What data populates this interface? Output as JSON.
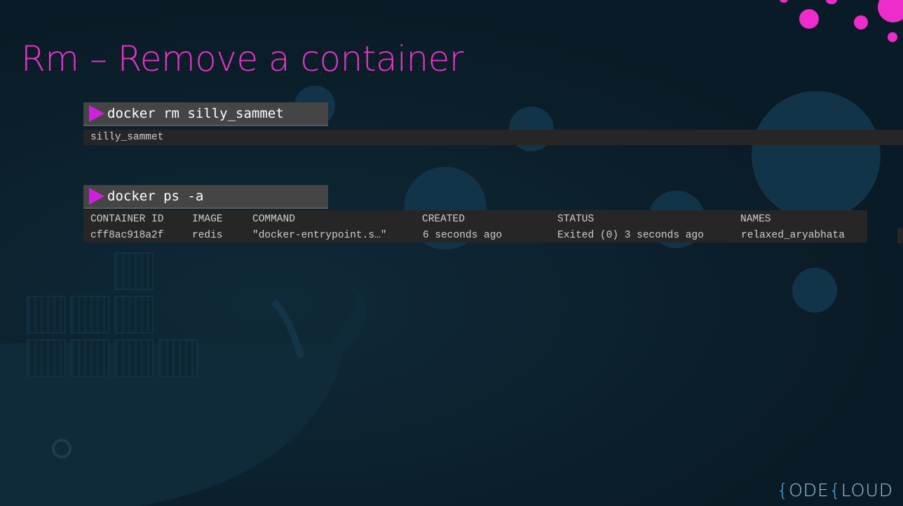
{
  "slide": {
    "title": "Rm – Remove a container"
  },
  "commands": [
    {
      "command": "docker rm silly_sammet",
      "output_lines": [
        "silly_sammet"
      ]
    },
    {
      "command": "docker ps -a",
      "table": {
        "headers": [
          "CONTAINER ID",
          "IMAGE",
          "COMMAND",
          "CREATED",
          "STATUS",
          "NAMES"
        ],
        "rows": [
          [
            "cff8ac918a2f",
            "redis",
            "\"docker-entrypoint.s…\"",
            "6 seconds ago",
            "Exited (0) 3 seconds ago",
            "relaxed_aryabhata"
          ]
        ]
      }
    }
  ],
  "logo": {
    "left_bracket": "{",
    "word1": "ODE",
    "right_bracket": "{",
    "word2": "LOUD"
  },
  "colors": {
    "title": "#e535c7",
    "prompt_icon": "#d11fe0",
    "background": "#0b1f2b",
    "command_bar": "#454545",
    "output_panel": "#262626"
  },
  "icons": [
    "prompt-triangle-icon",
    "docker-whale-icon"
  ]
}
